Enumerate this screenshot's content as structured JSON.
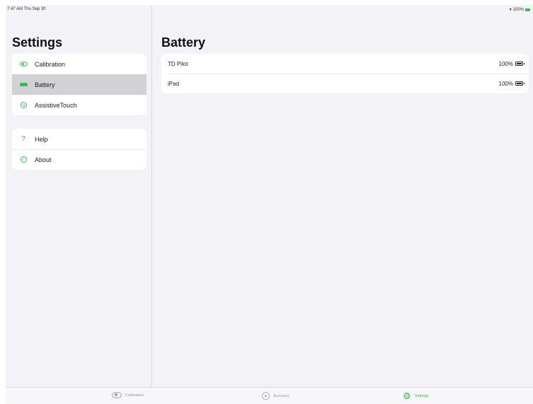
{
  "status_bar": {
    "time_date": "7:47 AM  Thu Sep 30",
    "wifi_icon": "wifi-icon",
    "battery_text": "100%"
  },
  "sidebar": {
    "title": "Settings",
    "group1": [
      {
        "label": "Calibration",
        "icon": "eye-icon"
      },
      {
        "label": "Battery",
        "icon": "battery-icon",
        "selected": true
      },
      {
        "label": "AssistiveTouch",
        "icon": "assistivetouch-icon"
      }
    ],
    "group2": [
      {
        "label": "Help",
        "icon": "question-icon"
      },
      {
        "label": "About",
        "icon": "info-icon"
      }
    ]
  },
  "main": {
    "title": "Battery",
    "rows": [
      {
        "label": "TD Pilot",
        "value": "100%"
      },
      {
        "label": "iPad",
        "value": "100%"
      }
    ]
  },
  "tab_bar": {
    "tabs": [
      {
        "label": "Calibration",
        "icon": "eye-icon"
      },
      {
        "label": "Accuracy",
        "icon": "target-icon"
      },
      {
        "label": "Settings",
        "icon": "gear-icon",
        "active": true
      }
    ]
  },
  "colors": {
    "accent": "#2fbf4f",
    "background": "#f2f2f7",
    "selected_row": "#d1d1d6"
  }
}
